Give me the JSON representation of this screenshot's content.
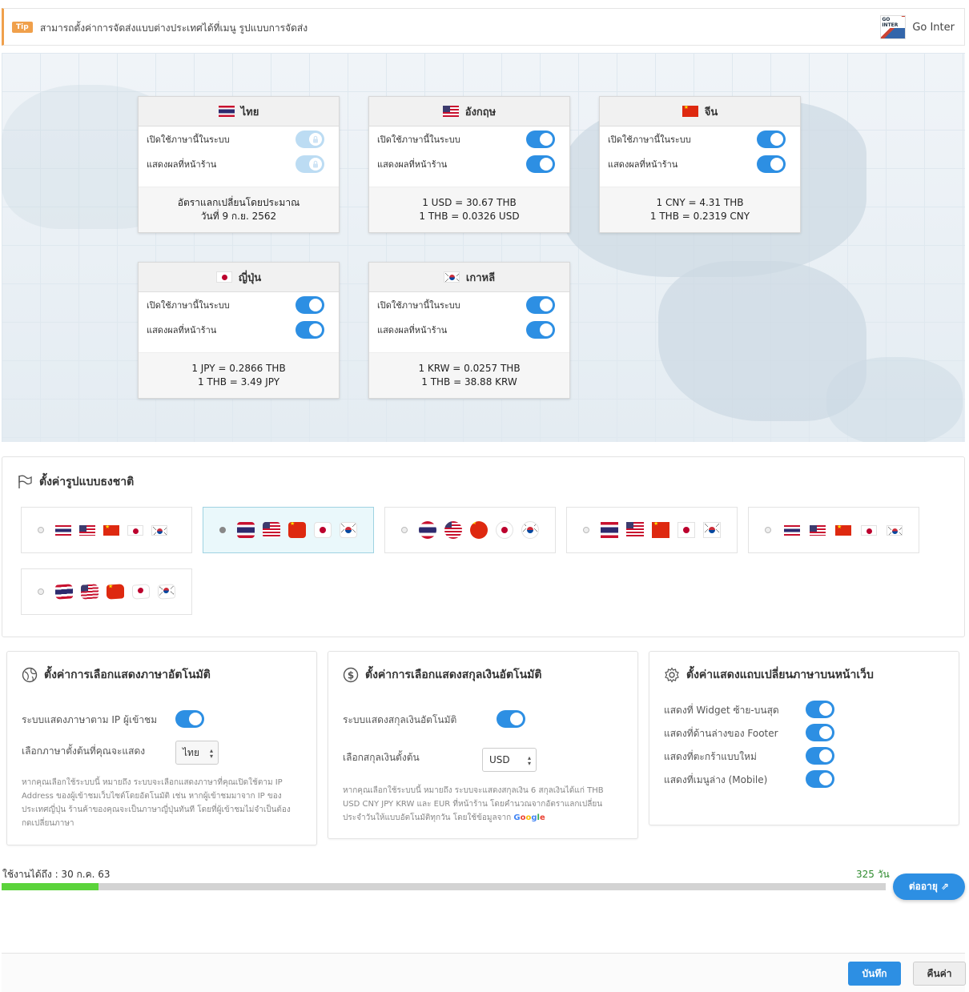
{
  "tip": {
    "badge": "Tip",
    "text": "สามารถตั้งค่าการจัดส่งแบบต่างประเทศได้ที่เมนู รูปแบบการจัดส่ง",
    "brand_logo_text": "GO INTER",
    "brand_label": "Go Inter"
  },
  "languages": [
    {
      "name": "ไทย",
      "flag": "th",
      "enable_label": "เปิดใช้ภาษานี้ในระบบ",
      "enabled": true,
      "locked": true,
      "show_label": "แสดงผลที่หน้าร้าน",
      "shown": true,
      "line1": "อัตราแลกเปลี่ยนโดยประมาณ",
      "line2": "วันที่ 9 ก.ย. 2562"
    },
    {
      "name": "อังกฤษ",
      "flag": "us",
      "enable_label": "เปิดใช้ภาษานี้ในระบบ",
      "enabled": true,
      "locked": false,
      "show_label": "แสดงผลที่หน้าร้าน",
      "shown": true,
      "line1": "1 USD = 30.67 THB",
      "line2": "1 THB = 0.0326 USD"
    },
    {
      "name": "จีน",
      "flag": "cn",
      "enable_label": "เปิดใช้ภาษานี้ในระบบ",
      "enabled": true,
      "locked": false,
      "show_label": "แสดงผลที่หน้าร้าน",
      "shown": true,
      "line1": "1 CNY = 4.31 THB",
      "line2": "1 THB = 0.2319 CNY"
    },
    {
      "name": "ญี่ปุ่น",
      "flag": "jp",
      "enable_label": "เปิดใช้ภาษานี้ในระบบ",
      "enabled": true,
      "locked": false,
      "show_label": "แสดงผลที่หน้าร้าน",
      "shown": true,
      "line1": "1 JPY = 0.2866 THB",
      "line2": "1 THB = 3.49 JPY"
    },
    {
      "name": "เกาหลี",
      "flag": "kr",
      "enable_label": "เปิดใช้ภาษานี้ในระบบ",
      "enabled": true,
      "locked": false,
      "show_label": "แสดงผลที่หน้าร้าน",
      "shown": true,
      "line1": "1 KRW = 0.0257 THB",
      "line2": "1 THB = 38.88 KRW"
    }
  ],
  "flag_style": {
    "title": "ตั้งค่ารูปแบบธงชาติ",
    "title_icon": "flag-outline-icon",
    "selected_index": 1,
    "styles": [
      "plain",
      "rounded",
      "round",
      "square",
      "plain",
      "waving"
    ]
  },
  "auto_language": {
    "title": "ตั้งค่าการเลือกแสดงภาษาอัตโนมัติ",
    "title_icon": "globe-icon",
    "toggle_label": "ระบบแสดงภาษาตาม IP ผู้เข้าชม",
    "toggle_on": true,
    "select_label": "เลือกภาษาตั้งต้นที่คุณจะแสดง",
    "select_value": "ไทย",
    "note": "หากคุณเลือกใช้ระบบนี้ หมายถึง ระบบจะเลือกแสดงภาษาที่คุณเปิดใช้ตาม IP Address ของผู้เข้าชมเว็บไซต์โดยอัตโนมัติ เช่น หากผู้เข้าชมมาจาก IP ของประเทศญี่ปุ่น ร้านค้าของคุณจะเป็นภาษาญี่ปุ่นทันที โดยที่ผู้เข้าชมไม่จำเป็นต้องกดเปลี่ยนภาษา"
  },
  "auto_currency": {
    "title": "ตั้งค่าการเลือกแสดงสกุลเงินอัตโนมัติ",
    "title_icon": "dollar-circle-icon",
    "toggle_label": "ระบบแสดงสกุลเงินอัตโนมัติ",
    "toggle_on": true,
    "select_label": "เลือกสกุลเงินตั้งต้น",
    "select_value": "USD",
    "note": "หากคุณเลือกใช้ระบบนี้ หมายถึง ระบบจะแสดงสกุลเงิน 6 สกุลเงินได้แก่ THB USD CNY JPY KRW และ EUR ที่หน้าร้าน โดยคำนวณจากอัตราแลกเปลี่ยนประจำวันให้แบบอัตโนมัติทุกวัน โดยใช้ข้อมูลจาก",
    "google_label": "Google"
  },
  "switcher_bar": {
    "title": "ตั้งค่าแสดงแถบเปลี่ยนภาษาบนหน้าเว็บ",
    "title_icon": "gear-icon",
    "items": [
      {
        "label": "แสดงที่ Widget ซ้าย-บนสุด",
        "on": true
      },
      {
        "label": "แสดงที่ด้านล่างของ Footer",
        "on": true
      },
      {
        "label": "แสดงที่ตะกร้าแบบใหม่",
        "on": true
      },
      {
        "label": "แสดงที่เมนูล่าง (Mobile)",
        "on": true
      }
    ]
  },
  "usage": {
    "label": "ใช้งานได้ถึง : 30 ก.ค. 63",
    "days": "325 วัน",
    "progress_fraction": 0.11,
    "renew_label": "ต่ออายุ ⇗"
  },
  "footer": {
    "save_label": "บันทึก",
    "reset_label": "คืนค่า"
  },
  "colors": {
    "accent": "#2d8fe3",
    "tip": "#f0a04b",
    "progress": "#5bd33b"
  }
}
